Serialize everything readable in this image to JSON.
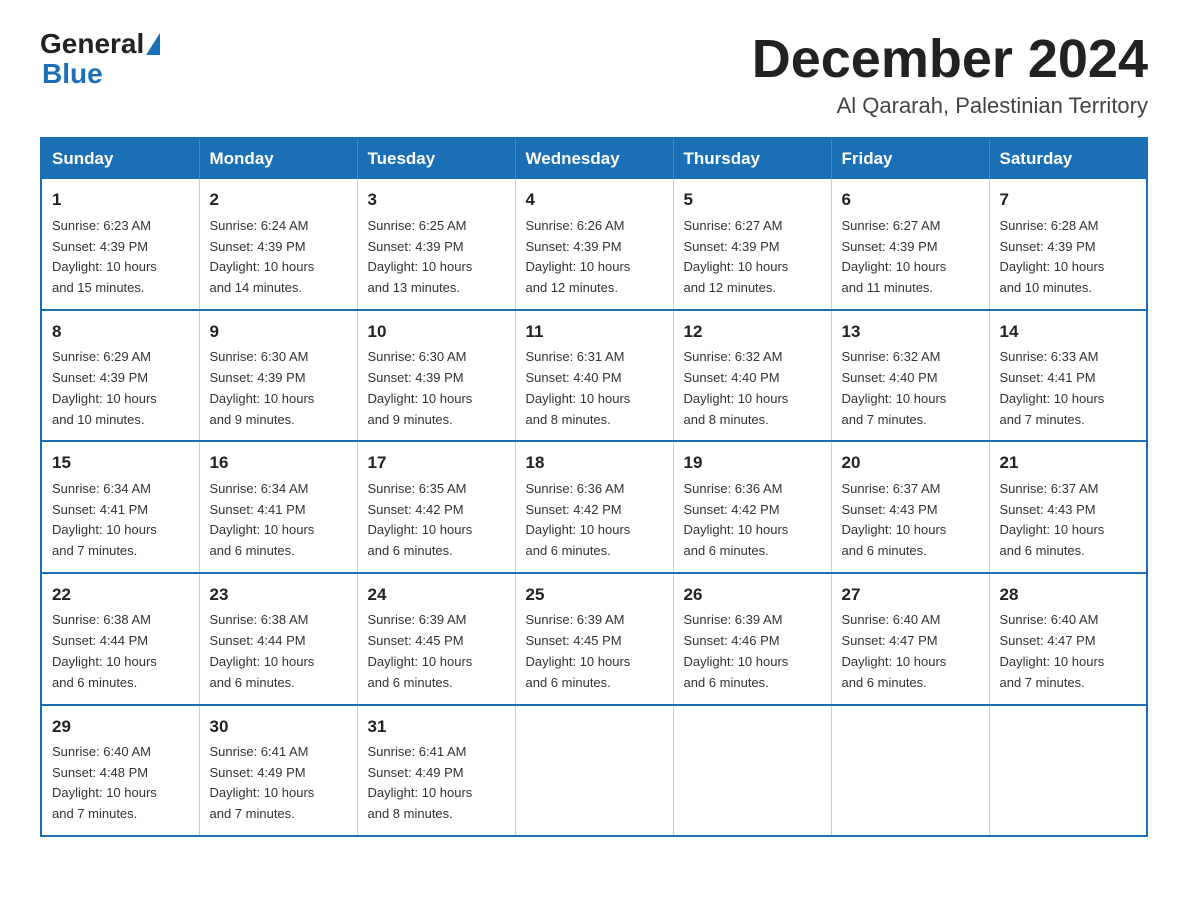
{
  "header": {
    "logo_general": "General",
    "logo_blue": "Blue",
    "month_title": "December 2024",
    "location": "Al Qararah, Palestinian Territory"
  },
  "weekdays": [
    "Sunday",
    "Monday",
    "Tuesday",
    "Wednesday",
    "Thursday",
    "Friday",
    "Saturday"
  ],
  "weeks": [
    [
      {
        "day": "1",
        "sunrise": "6:23 AM",
        "sunset": "4:39 PM",
        "daylight": "10 hours and 15 minutes."
      },
      {
        "day": "2",
        "sunrise": "6:24 AM",
        "sunset": "4:39 PM",
        "daylight": "10 hours and 14 minutes."
      },
      {
        "day": "3",
        "sunrise": "6:25 AM",
        "sunset": "4:39 PM",
        "daylight": "10 hours and 13 minutes."
      },
      {
        "day": "4",
        "sunrise": "6:26 AM",
        "sunset": "4:39 PM",
        "daylight": "10 hours and 12 minutes."
      },
      {
        "day": "5",
        "sunrise": "6:27 AM",
        "sunset": "4:39 PM",
        "daylight": "10 hours and 12 minutes."
      },
      {
        "day": "6",
        "sunrise": "6:27 AM",
        "sunset": "4:39 PM",
        "daylight": "10 hours and 11 minutes."
      },
      {
        "day": "7",
        "sunrise": "6:28 AM",
        "sunset": "4:39 PM",
        "daylight": "10 hours and 10 minutes."
      }
    ],
    [
      {
        "day": "8",
        "sunrise": "6:29 AM",
        "sunset": "4:39 PM",
        "daylight": "10 hours and 10 minutes."
      },
      {
        "day": "9",
        "sunrise": "6:30 AM",
        "sunset": "4:39 PM",
        "daylight": "10 hours and 9 minutes."
      },
      {
        "day": "10",
        "sunrise": "6:30 AM",
        "sunset": "4:39 PM",
        "daylight": "10 hours and 9 minutes."
      },
      {
        "day": "11",
        "sunrise": "6:31 AM",
        "sunset": "4:40 PM",
        "daylight": "10 hours and 8 minutes."
      },
      {
        "day": "12",
        "sunrise": "6:32 AM",
        "sunset": "4:40 PM",
        "daylight": "10 hours and 8 minutes."
      },
      {
        "day": "13",
        "sunrise": "6:32 AM",
        "sunset": "4:40 PM",
        "daylight": "10 hours and 7 minutes."
      },
      {
        "day": "14",
        "sunrise": "6:33 AM",
        "sunset": "4:41 PM",
        "daylight": "10 hours and 7 minutes."
      }
    ],
    [
      {
        "day": "15",
        "sunrise": "6:34 AM",
        "sunset": "4:41 PM",
        "daylight": "10 hours and 7 minutes."
      },
      {
        "day": "16",
        "sunrise": "6:34 AM",
        "sunset": "4:41 PM",
        "daylight": "10 hours and 6 minutes."
      },
      {
        "day": "17",
        "sunrise": "6:35 AM",
        "sunset": "4:42 PM",
        "daylight": "10 hours and 6 minutes."
      },
      {
        "day": "18",
        "sunrise": "6:36 AM",
        "sunset": "4:42 PM",
        "daylight": "10 hours and 6 minutes."
      },
      {
        "day": "19",
        "sunrise": "6:36 AM",
        "sunset": "4:42 PM",
        "daylight": "10 hours and 6 minutes."
      },
      {
        "day": "20",
        "sunrise": "6:37 AM",
        "sunset": "4:43 PM",
        "daylight": "10 hours and 6 minutes."
      },
      {
        "day": "21",
        "sunrise": "6:37 AM",
        "sunset": "4:43 PM",
        "daylight": "10 hours and 6 minutes."
      }
    ],
    [
      {
        "day": "22",
        "sunrise": "6:38 AM",
        "sunset": "4:44 PM",
        "daylight": "10 hours and 6 minutes."
      },
      {
        "day": "23",
        "sunrise": "6:38 AM",
        "sunset": "4:44 PM",
        "daylight": "10 hours and 6 minutes."
      },
      {
        "day": "24",
        "sunrise": "6:39 AM",
        "sunset": "4:45 PM",
        "daylight": "10 hours and 6 minutes."
      },
      {
        "day": "25",
        "sunrise": "6:39 AM",
        "sunset": "4:45 PM",
        "daylight": "10 hours and 6 minutes."
      },
      {
        "day": "26",
        "sunrise": "6:39 AM",
        "sunset": "4:46 PM",
        "daylight": "10 hours and 6 minutes."
      },
      {
        "day": "27",
        "sunrise": "6:40 AM",
        "sunset": "4:47 PM",
        "daylight": "10 hours and 6 minutes."
      },
      {
        "day": "28",
        "sunrise": "6:40 AM",
        "sunset": "4:47 PM",
        "daylight": "10 hours and 7 minutes."
      }
    ],
    [
      {
        "day": "29",
        "sunrise": "6:40 AM",
        "sunset": "4:48 PM",
        "daylight": "10 hours and 7 minutes."
      },
      {
        "day": "30",
        "sunrise": "6:41 AM",
        "sunset": "4:49 PM",
        "daylight": "10 hours and 7 minutes."
      },
      {
        "day": "31",
        "sunrise": "6:41 AM",
        "sunset": "4:49 PM",
        "daylight": "10 hours and 8 minutes."
      },
      null,
      null,
      null,
      null
    ]
  ],
  "labels": {
    "sunrise_prefix": "Sunrise: ",
    "sunset_prefix": "Sunset: ",
    "daylight_prefix": "Daylight: "
  }
}
